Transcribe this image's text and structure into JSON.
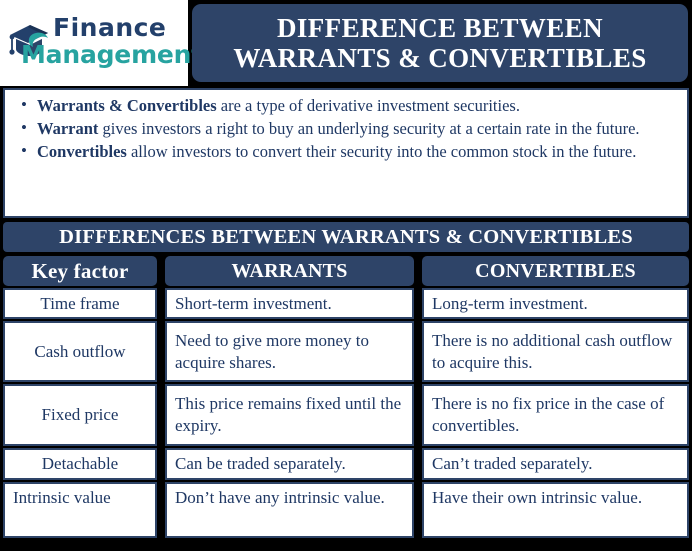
{
  "brand": {
    "line1": "Finance",
    "line2": "Management",
    "icon": "graduation-cap-icon",
    "navy": "#23406B",
    "teal": "#27A3A0"
  },
  "title": {
    "line1": "DIFFERENCE BETWEEN",
    "line2": "WARRANTS & CONVERTIBLES"
  },
  "intro": {
    "bullets": [
      {
        "lead": "Warrants & Convertibles",
        "rest": " are a type of derivative investment securities."
      },
      {
        "lead": "Warrant",
        "rest": " gives investors a right to buy an underlying security at a certain rate in the future."
      },
      {
        "lead": "Convertibles",
        "rest": " allow investors to convert their security into the common stock in the future."
      }
    ]
  },
  "section": {
    "heading": "DIFFERENCES BETWEEN WARRANTS & CONVERTIBLES"
  },
  "table": {
    "headers": [
      "Key factor",
      "WARRANTS",
      "CONVERTIBLES"
    ],
    "rows": [
      {
        "factor": "Time frame",
        "warrants": "Short-term investment.",
        "convertibles": "Long-term investment."
      },
      {
        "factor": "Cash outflow",
        "warrants": "Need to give more money to acquire shares.",
        "convertibles": "There is no additional cash outflow to acquire this."
      },
      {
        "factor": "Fixed price",
        "warrants": "This price remains fixed until the expiry.",
        "convertibles": "There is no fix price in the case of convertibles."
      },
      {
        "factor": "Detachable",
        "warrants": "Can be traded separately.",
        "convertibles": "Can’t traded separately."
      },
      {
        "factor": "Intrinsic value",
        "warrants": "Don’t have any intrinsic value.",
        "convertibles": "Have their own intrinsic value."
      }
    ]
  },
  "colors": {
    "navy": "#2E4468",
    "text_navy": "#1F3864",
    "white": "#ffffff",
    "background": "#000000"
  }
}
